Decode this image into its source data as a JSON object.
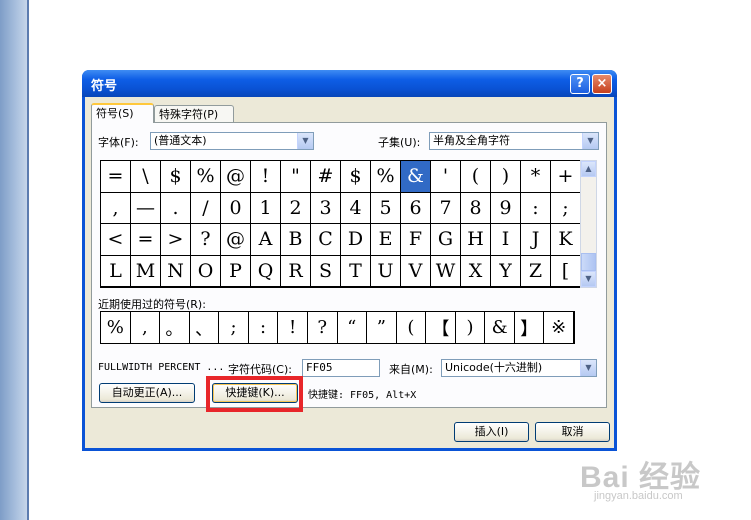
{
  "dialog": {
    "title": "符号",
    "help_label": "?",
    "close_label": "×"
  },
  "tabs": [
    {
      "label": "符号(S)"
    },
    {
      "label": "特殊字符(P)"
    }
  ],
  "font": {
    "label": "字体(F):",
    "value": "(普通文本)"
  },
  "subset": {
    "label": "子集(U):",
    "value": "半角及全角字符"
  },
  "symbols": [
    [
      "=",
      "\\",
      "$",
      "%",
      "@",
      "!",
      "\"",
      "#",
      "$",
      "%",
      "&",
      "'",
      "(",
      ")",
      "*",
      "+"
    ],
    [
      ",",
      "—",
      ".",
      "/",
      "0",
      "1",
      "2",
      "3",
      "4",
      "5",
      "6",
      "7",
      "8",
      "9",
      ":",
      ";"
    ],
    [
      "<",
      "=",
      ">",
      "?",
      "@",
      "A",
      "B",
      "C",
      "D",
      "E",
      "F",
      "G",
      "H",
      "I",
      "J",
      "K"
    ],
    [
      "L",
      "M",
      "N",
      "O",
      "P",
      "Q",
      "R",
      "S",
      "T",
      "U",
      "V",
      "W",
      "X",
      "Y",
      "Z",
      "["
    ]
  ],
  "selected_symbol_index": 10,
  "recent": {
    "label": "近期使用过的符号(R):",
    "items": [
      "%",
      ",",
      "。",
      "、",
      ";",
      ":",
      "!",
      "?",
      "“",
      "”",
      "(",
      "【",
      ")",
      "&",
      "】",
      "※"
    ]
  },
  "char_name": "FULLWIDTH PERCENT ...",
  "char_code": {
    "label": "字符代码(C):",
    "value": "FF05"
  },
  "from": {
    "label": "来自(M):",
    "value": "Unicode(十六进制)"
  },
  "buttons": {
    "autocorrect": "自动更正(A)...",
    "shortcut": "快捷键(K)...",
    "insert": "插入(I)",
    "cancel": "取消"
  },
  "shortcut_info": "快捷键: FF05, Alt+X",
  "watermark": {
    "logo": "Bai 经验",
    "url": "jingyan.baidu.com"
  },
  "colors": {
    "titlebar": "#0a52d4",
    "selection": "#316ac5",
    "highlight": "#e8262a"
  }
}
